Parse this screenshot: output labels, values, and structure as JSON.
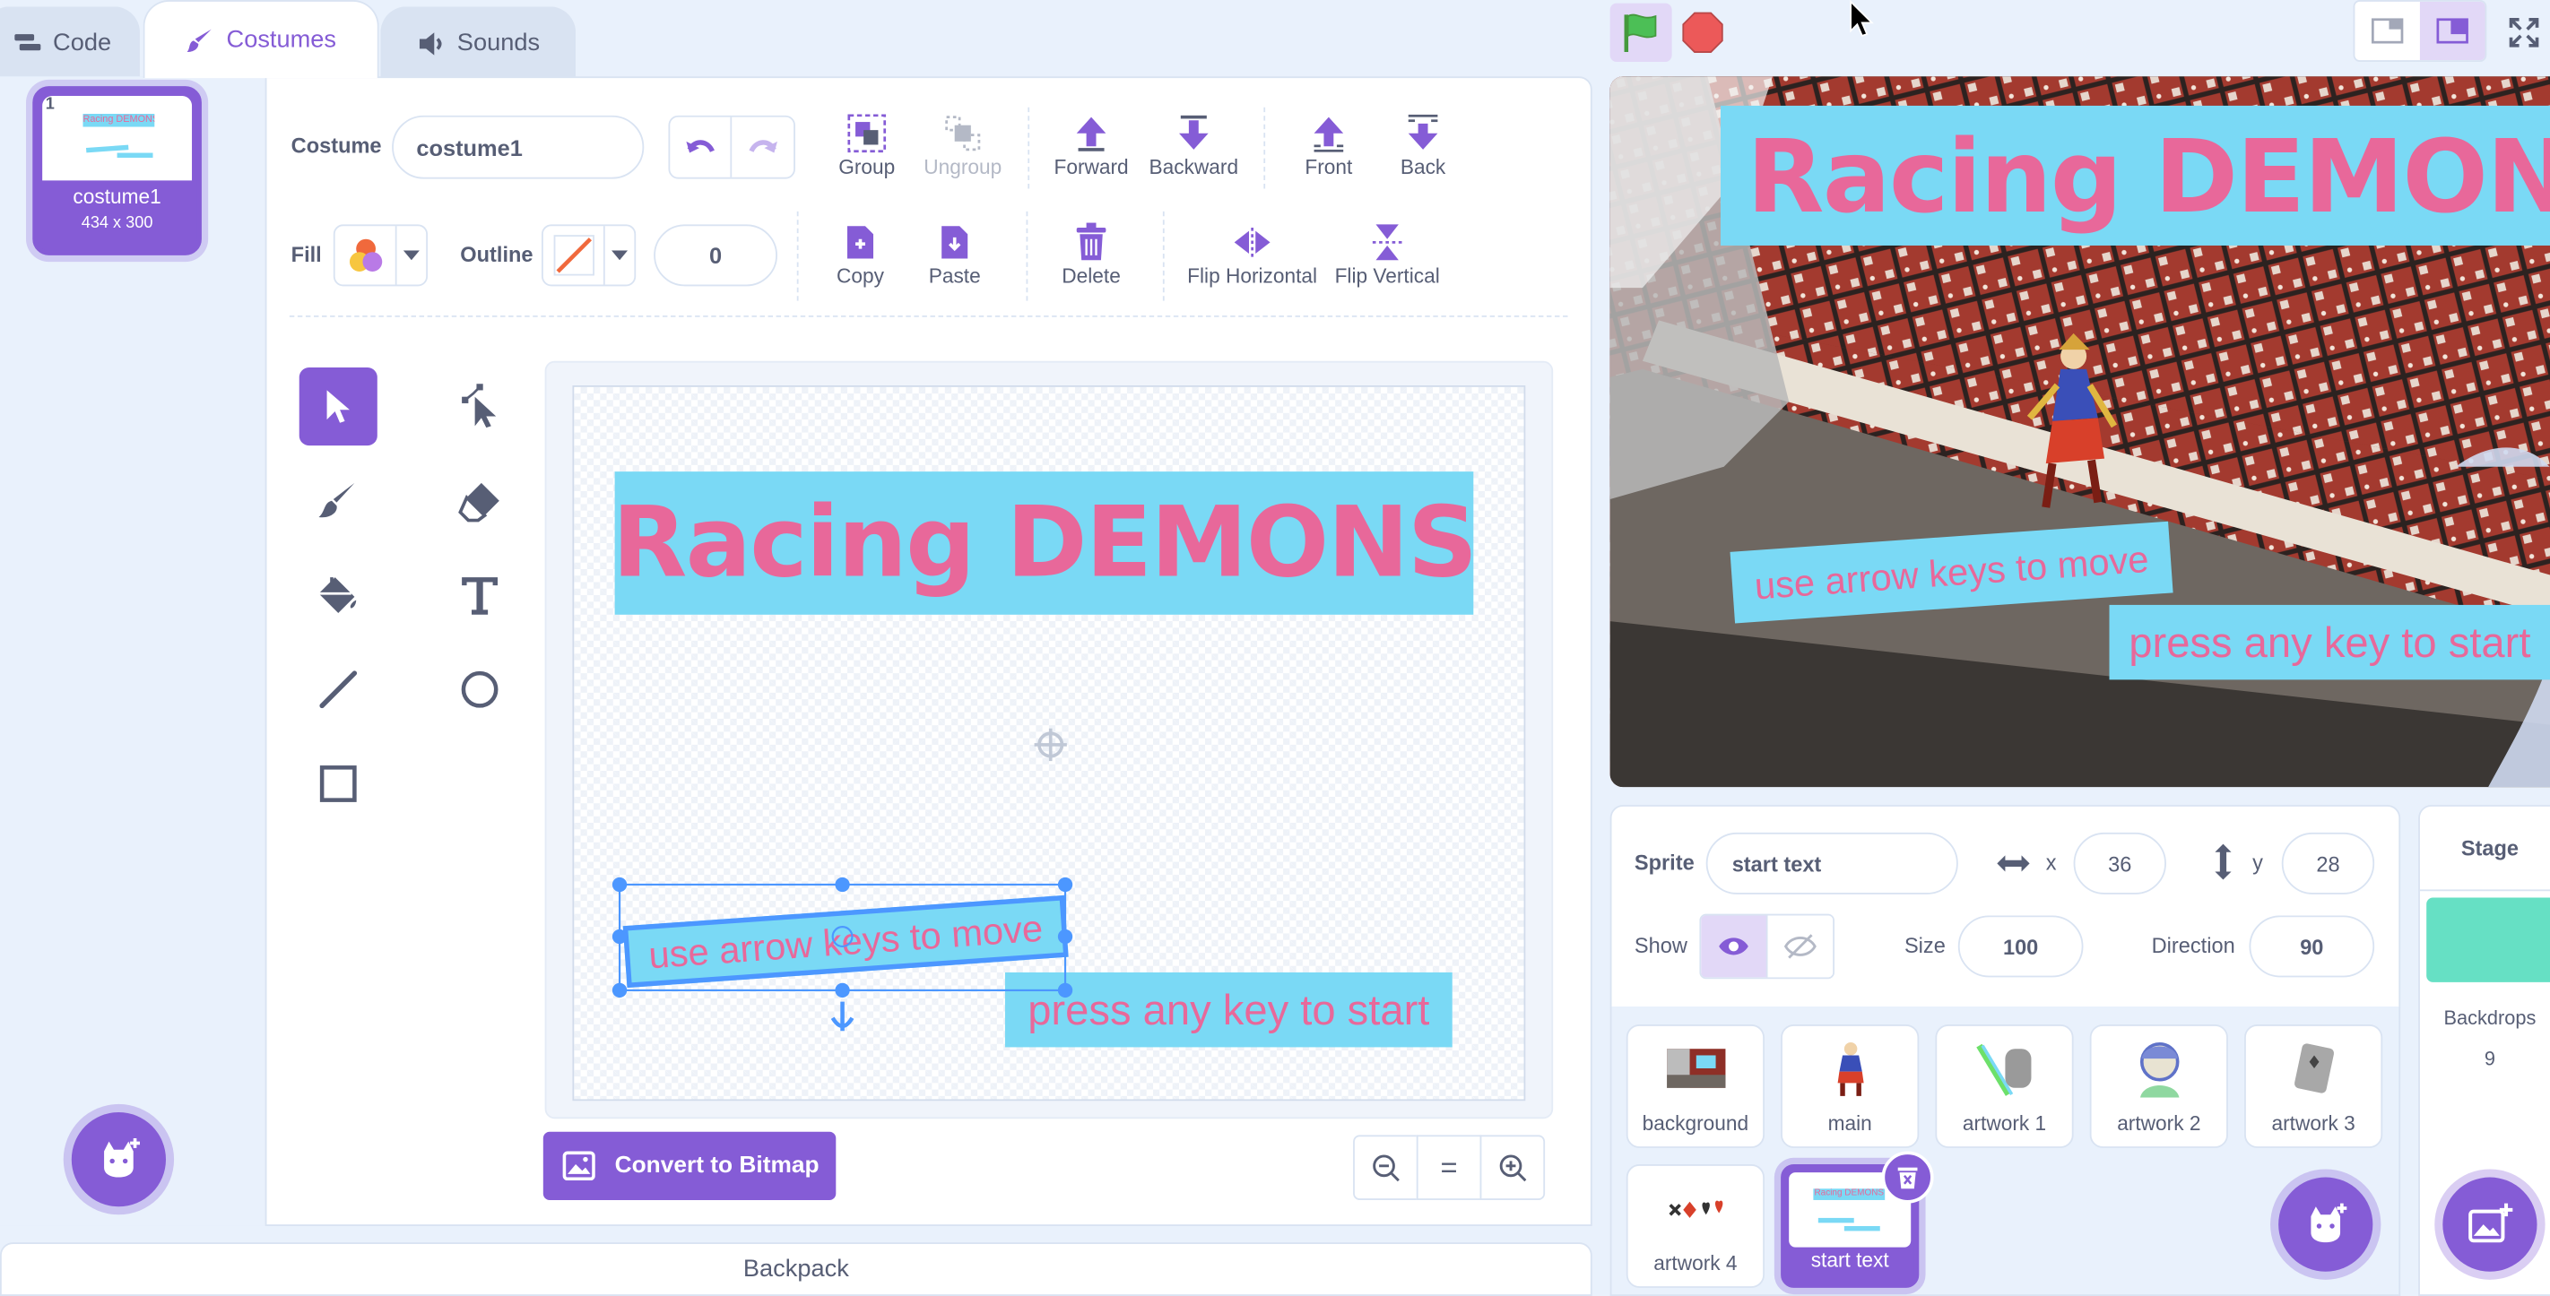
{
  "tabs": {
    "code": "Code",
    "costumes": "Costumes",
    "sounds": "Sounds"
  },
  "costume_list": [
    {
      "index": "1",
      "name": "costume1",
      "size": "434 x 300",
      "thumb_text": "Racing DEMONS"
    }
  ],
  "toolbar": {
    "costume_label": "Costume",
    "costume_name": "costume1",
    "group": "Group",
    "ungroup": "Ungroup",
    "forward": "Forward",
    "backward": "Backward",
    "front": "Front",
    "back": "Back",
    "fill_label": "Fill",
    "outline_label": "Outline",
    "outline_width": "0",
    "copy": "Copy",
    "paste": "Paste",
    "delete": "Delete",
    "flip_horizontal": "Flip Horizontal",
    "flip_vertical": "Flip Vertical"
  },
  "canvas": {
    "title": "Racing DEMONS",
    "text1": "use arrow keys to move",
    "text2": "press any key to start"
  },
  "convert_button": "Convert to Bitmap",
  "zoom": {
    "equal": "="
  },
  "backpack": "Backpack",
  "stage": {
    "title": "Racing DEMONS",
    "text1": "use arrow keys to move",
    "text2": "press any key to start"
  },
  "sprite_info": {
    "sprite_label": "Sprite",
    "sprite_name": "start text",
    "x_label": "x",
    "x": "36",
    "y_label": "y",
    "y": "28",
    "show_label": "Show",
    "size_label": "Size",
    "size": "100",
    "direction_label": "Direction",
    "direction": "90"
  },
  "sprites": [
    "background",
    "main",
    "artwork 1",
    "artwork 2",
    "artwork 3",
    "artwork 4",
    "start text"
  ],
  "stage_panel": {
    "title": "Stage",
    "backdrops_label": "Backdrops",
    "backdrops_count": "9"
  },
  "colors": {
    "accent": "#855cd6",
    "title_pink": "#e8689a",
    "title_bg": "#7ad9f5",
    "green_flag": "#4cbf56",
    "stop": "#ec5959"
  }
}
